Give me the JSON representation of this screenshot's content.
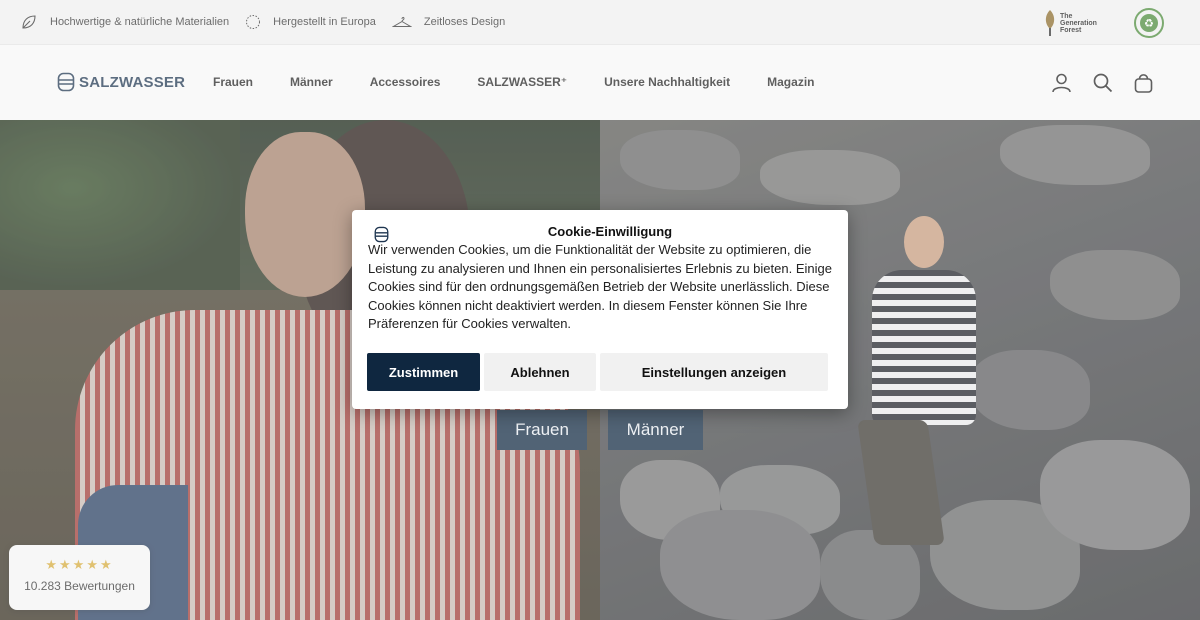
{
  "topbar": {
    "usps": [
      {
        "icon": "leaf-icon",
        "label": "Hochwertige & natürliche Materialien"
      },
      {
        "icon": "globe-dotted-icon",
        "label": "Hergestellt in Europa"
      },
      {
        "icon": "hanger-icon",
        "label": "Zeitloses Design"
      }
    ],
    "badges": {
      "generation_forest": "The Generation Forest",
      "gots_icon": "gots-badge-icon"
    }
  },
  "header": {
    "logo_text": "SALZWASSER",
    "nav": [
      {
        "label": "Frauen"
      },
      {
        "label": "Männer"
      },
      {
        "label": "Accessoires"
      },
      {
        "label": "SALZWASSER⁺"
      },
      {
        "label": "Unsere Nachhaltigkeit"
      },
      {
        "label": "Magazin"
      }
    ],
    "icons": [
      "account-icon",
      "search-icon",
      "bag-icon"
    ]
  },
  "hero": {
    "buttons": [
      {
        "label": "Frauen"
      },
      {
        "label": "Männer"
      }
    ]
  },
  "reviews": {
    "stars": "★★★★★",
    "rating_stars_shown": 5,
    "count_label": "10.283 Bewertungen"
  },
  "cookie": {
    "title": "Cookie-Einwilligung",
    "text": "Wir verwenden Cookies, um die Funktionalität der Website zu optimieren, die Leistung zu analysieren und Ihnen ein personalisiertes Erlebnis zu bieten. Einige Cookies sind für den ordnungsgemäßen Betrieb der Website unerlässlich. Diese Cookies können nicht deaktiviert werden. In diesem Fenster können Sie Ihre Präferenzen für Cookies verwalten.",
    "accept_label": "Zustimmen",
    "decline_label": "Ablehnen",
    "settings_label": "Einstellungen anzeigen"
  },
  "colors": {
    "brand_navy": "#0f2740",
    "topbar_bg": "#efefef",
    "header_bg": "#f7f7f7",
    "star_gold": "#d4a93a"
  }
}
